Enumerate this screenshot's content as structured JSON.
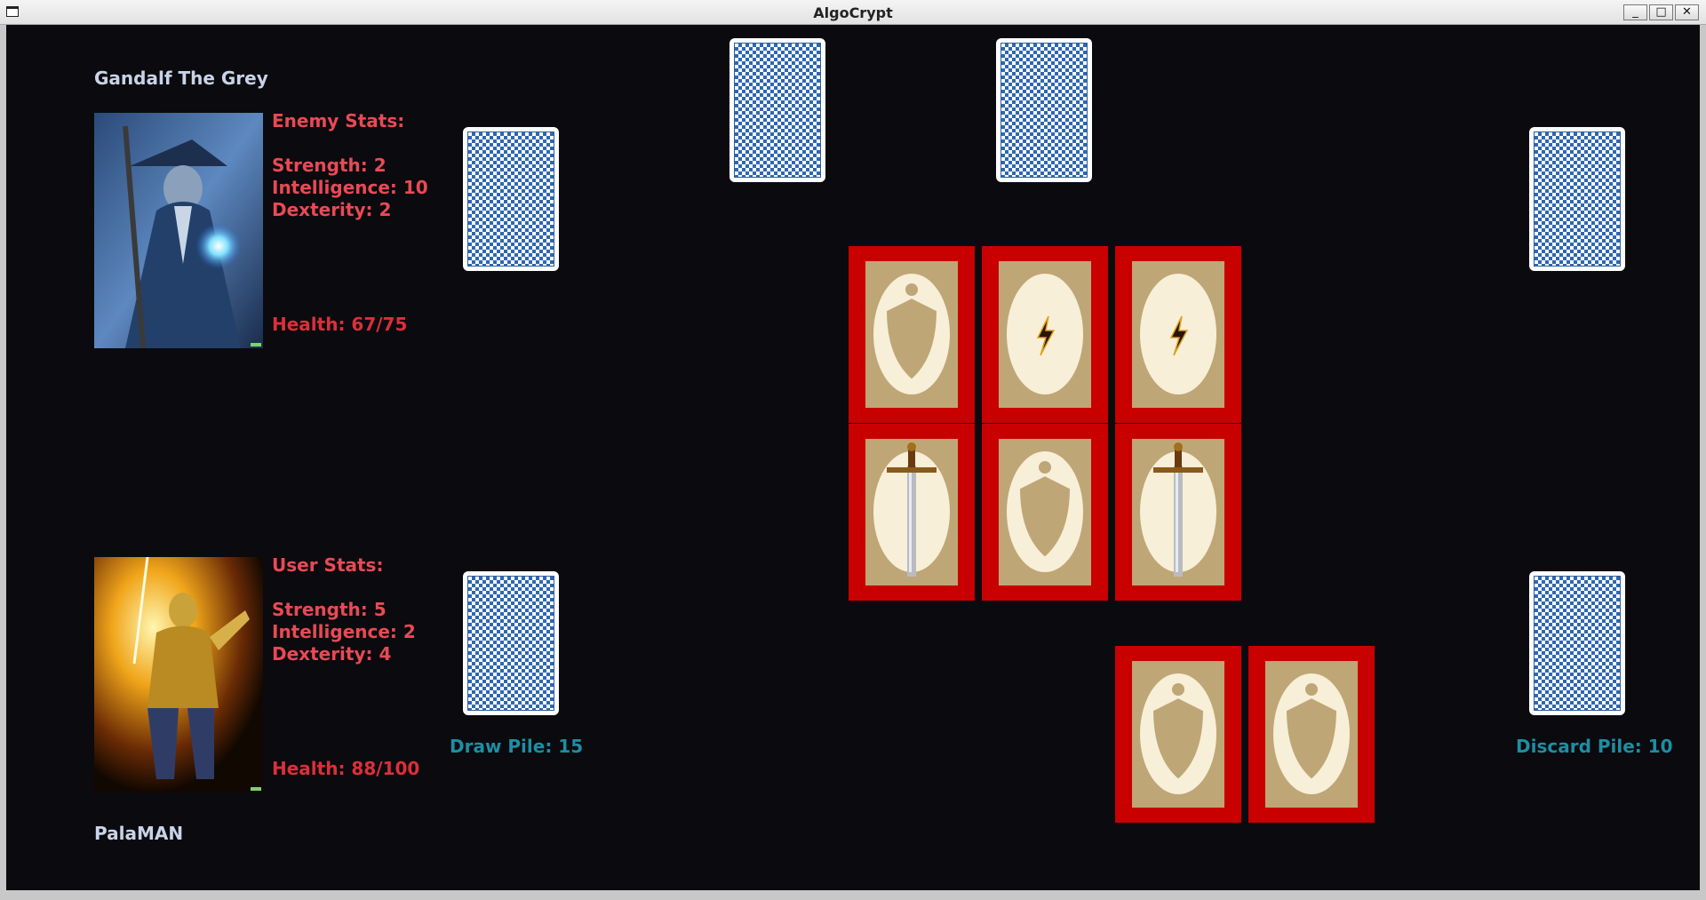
{
  "window": {
    "title": "AlgoCrypt",
    "minimize": "_",
    "maximize": "□",
    "close": "✕"
  },
  "enemy": {
    "name": "Gandalf The Grey",
    "stats_heading": "Enemy Stats:",
    "strength": "Strength: 2",
    "intelligence": "Intelligence: 10",
    "dexterity": "Dexterity: 2",
    "health": "Health: 67/75"
  },
  "user": {
    "name": "PalaMAN",
    "stats_heading": "User Stats:",
    "strength": "Strength: 5",
    "intelligence": "Intelligence: 2",
    "dexterity": "Dexterity: 4",
    "health": "Health: 88/100"
  },
  "piles": {
    "draw_label": "Draw Pile: 15",
    "discard_label": "Discard Pile: 10"
  },
  "board": {
    "played_row_1": [
      "shield",
      "lightning",
      "lightning"
    ],
    "played_row_2": [
      "sword",
      "shield",
      "sword"
    ],
    "hand": [
      "shield",
      "shield"
    ]
  },
  "colors": {
    "background": "#0b0a0e",
    "stat_text": "#e84a55",
    "health_text": "#dc2f3a",
    "name_text": "#c9d3e8",
    "pile_text": "#1d8ea3",
    "card_frame": "#c90000",
    "card_back": "#2e67b2"
  }
}
